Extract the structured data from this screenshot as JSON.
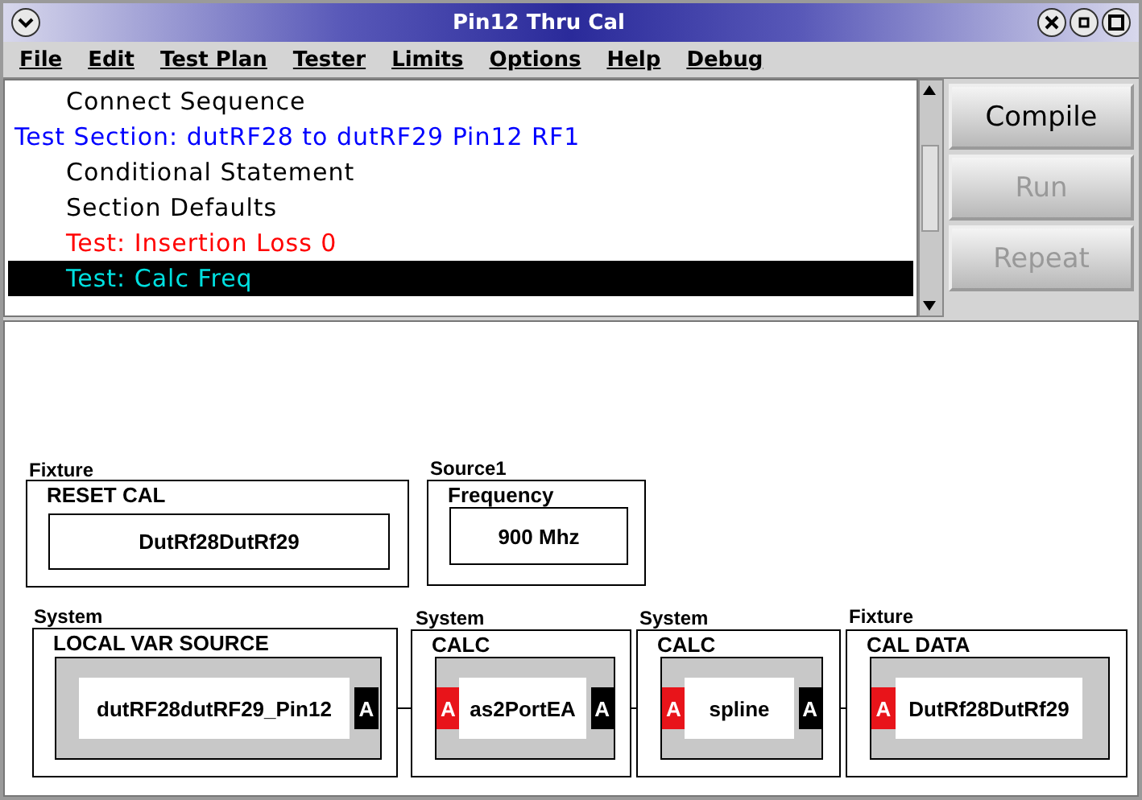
{
  "window": {
    "title": "Pin12 Thru Cal"
  },
  "menu": [
    {
      "label": "File"
    },
    {
      "label": "Edit"
    },
    {
      "label": "Test Plan"
    },
    {
      "label": "Tester"
    },
    {
      "label": "Limits"
    },
    {
      "label": "Options"
    },
    {
      "label": "Help"
    },
    {
      "label": "Debug"
    }
  ],
  "plan_items": [
    {
      "kind": "entry",
      "label": "Connect Sequence",
      "color": "#000000",
      "selected": false
    },
    {
      "kind": "section",
      "label": "Test Section: dutRF28 to dutRF29 Pin12 RF1",
      "color": "#0000ff",
      "selected": false
    },
    {
      "kind": "entry",
      "label": "Conditional Statement",
      "color": "#000000",
      "selected": false
    },
    {
      "kind": "entry",
      "label": "Section Defaults",
      "color": "#000000",
      "selected": false
    },
    {
      "kind": "entry",
      "label": "Test: Insertion Loss 0",
      "color": "#ff0000",
      "selected": false
    },
    {
      "kind": "entry",
      "label": "Test: Calc Freq",
      "color": "#00e0e0",
      "selected": true
    }
  ],
  "buttons": [
    {
      "label": "Compile",
      "disabled": false
    },
    {
      "label": "Run",
      "disabled": true
    },
    {
      "label": "Repeat",
      "disabled": true
    }
  ],
  "diagram": {
    "nodes": [
      {
        "kind": "simple",
        "category": "Fixture",
        "title": "RESET CAL",
        "value": "DutRf28DutRf29"
      },
      {
        "kind": "simple",
        "category": "Source1",
        "title": "Frequency",
        "value": "900  Mhz"
      },
      {
        "kind": "block",
        "category": "System",
        "title": "LOCAL VAR SOURCE",
        "value": "dutRF28dutRF29_Pin12",
        "output_port": "A"
      },
      {
        "kind": "block",
        "category": "System",
        "title": "CALC",
        "value": "as2PortEA",
        "input_port": "A",
        "output_port": "A"
      },
      {
        "kind": "block",
        "category": "System",
        "title": "CALC",
        "value": "spline",
        "input_port": "A",
        "output_port": "A"
      },
      {
        "kind": "block",
        "category": "Fixture",
        "title": "CAL DATA",
        "value": "DutRf28DutRf29",
        "input_port": "A"
      }
    ]
  }
}
